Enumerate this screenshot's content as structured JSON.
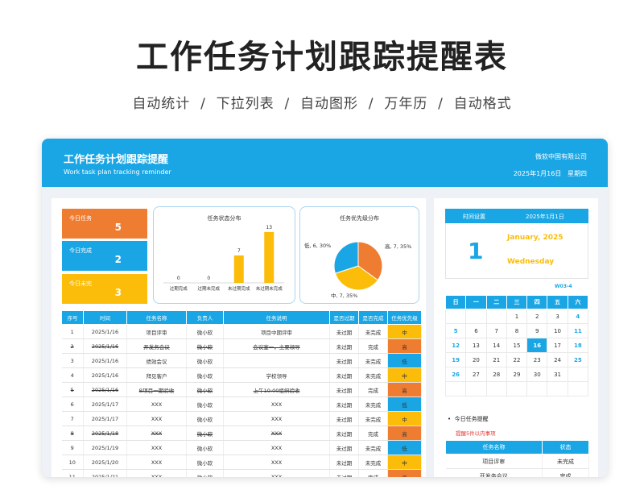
{
  "hero": {
    "title": "工作任务计划跟踪提醒表",
    "subtitle": "自动统计  /  下拉列表  /  自动图形  /  万年历  /  自动格式"
  },
  "header": {
    "title": "工作任务计划跟踪提醒",
    "subtitle": "Work task plan tracking reminder",
    "company": "微软中国有限公司",
    "date": "2025年1月16日",
    "weekday": "星期四"
  },
  "cards": [
    {
      "label": "今日任务",
      "value": "5",
      "color": "#ef7d31"
    },
    {
      "label": "今日完成",
      "value": "2",
      "color": "#1aa6e4"
    },
    {
      "label": "今日未完",
      "value": "3",
      "color": "#fbbd0a"
    }
  ],
  "status_chart": {
    "title": "任务状态分布"
  },
  "priority_chart": {
    "title": "任务优先级分布"
  },
  "chart_data": [
    {
      "type": "bar",
      "title": "任务状态分布",
      "categories": [
        "过期完成",
        "过期未完成",
        "未过期完成",
        "未过期未完成"
      ],
      "values": [
        0,
        0,
        7,
        13
      ],
      "ylim": [
        0,
        14
      ],
      "color": "#fbbd0a",
      "data_labels": true,
      "grid": false
    },
    {
      "type": "pie",
      "title": "任务优先级分布",
      "labels": [
        "高",
        "中",
        "低"
      ],
      "values": [
        7,
        7,
        6
      ],
      "percents": [
        "35%",
        "35%",
        "30%"
      ],
      "slice_labels": [
        "高, 7, 35%",
        "中, 7, 35%",
        "低, 6, 30%"
      ],
      "colors": [
        "#ef7d31",
        "#fbbd0a",
        "#1aa6e4"
      ]
    }
  ],
  "table": {
    "headers": [
      "序号",
      "时间",
      "任务名称",
      "负责人",
      "任务说明",
      "是否过期",
      "是否完成",
      "任务优先级"
    ],
    "rows": [
      {
        "no": "1",
        "date": "2025/1/16",
        "name": "项目评审",
        "owner": "微小软",
        "desc": "项目中期评审",
        "overdue": "未过期",
        "status": "未完成",
        "priority": "中",
        "done": false
      },
      {
        "no": "2",
        "date": "2025/1/16",
        "name": "开发务会议",
        "owner": "微小软",
        "desc": "会议室一，主要领导",
        "overdue": "未过期",
        "status": "完成",
        "priority": "高",
        "done": true
      },
      {
        "no": "3",
        "date": "2025/1/16",
        "name": "绩效会议",
        "owner": "微小软",
        "desc": "",
        "overdue": "未过期",
        "status": "未完成",
        "priority": "低",
        "done": false
      },
      {
        "no": "4",
        "date": "2025/1/16",
        "name": "拜见客户",
        "owner": "微小软",
        "desc": "学校领导",
        "overdue": "未过期",
        "status": "未完成",
        "priority": "中",
        "done": false
      },
      {
        "no": "5",
        "date": "2025/1/16",
        "name": "B项目一期验收",
        "owner": "微小软",
        "desc": "上午10:00组织验收",
        "overdue": "未过期",
        "status": "完成",
        "priority": "高",
        "done": true
      },
      {
        "no": "6",
        "date": "2025/1/17",
        "name": "XXX",
        "owner": "微小软",
        "desc": "XXX",
        "overdue": "未过期",
        "status": "未完成",
        "priority": "低",
        "done": false
      },
      {
        "no": "7",
        "date": "2025/1/17",
        "name": "XXX",
        "owner": "微小软",
        "desc": "XXX",
        "overdue": "未过期",
        "status": "未完成",
        "priority": "中",
        "done": false
      },
      {
        "no": "8",
        "date": "2025/1/18",
        "name": "XXX",
        "owner": "微小软",
        "desc": "XXX",
        "overdue": "未过期",
        "status": "完成",
        "priority": "高",
        "done": true
      },
      {
        "no": "9",
        "date": "2025/1/19",
        "name": "XXX",
        "owner": "微小软",
        "desc": "XXX",
        "overdue": "未过期",
        "status": "未完成",
        "priority": "低",
        "done": false
      },
      {
        "no": "10",
        "date": "2025/1/20",
        "name": "XXX",
        "owner": "微小软",
        "desc": "XXX",
        "overdue": "未过期",
        "status": "未完成",
        "priority": "中",
        "done": false
      },
      {
        "no": "11",
        "date": "2025/1/21",
        "name": "XXX",
        "owner": "微小软",
        "desc": "XXX",
        "overdue": "未过期",
        "status": "完成",
        "priority": "高",
        "done": true
      }
    ]
  },
  "priority_colors": {
    "高": "#ef7d31",
    "中": "#fbbd0a",
    "低": "#1aa6e4"
  },
  "calendar": {
    "label": "时间设置",
    "month_value": "2025年1月1日",
    "big_day": "1",
    "month_name": "January, 2025",
    "weekday": "Wednesday",
    "code": "W03-4",
    "weekdays": [
      "日",
      "一",
      "二",
      "三",
      "四",
      "五",
      "六"
    ],
    "weeks": [
      [
        "",
        "",
        "",
        "1",
        "2",
        "3",
        "4"
      ],
      [
        "5",
        "6",
        "7",
        "8",
        "9",
        "10",
        "11"
      ],
      [
        "12",
        "13",
        "14",
        "15",
        "16",
        "17",
        "18"
      ],
      [
        "19",
        "20",
        "21",
        "22",
        "23",
        "24",
        "25"
      ],
      [
        "26",
        "27",
        "28",
        "29",
        "30",
        "31",
        ""
      ],
      [
        "",
        "",
        "",
        "",
        "",
        "",
        ""
      ]
    ],
    "today": "16"
  },
  "reminder": {
    "title": "今日任务提醒",
    "note": "提醒5件以内事项",
    "headers": [
      "任务名称",
      "状态"
    ],
    "rows": [
      [
        "项目评审",
        "未完成"
      ],
      [
        "开发务会议",
        "完成"
      ]
    ]
  }
}
